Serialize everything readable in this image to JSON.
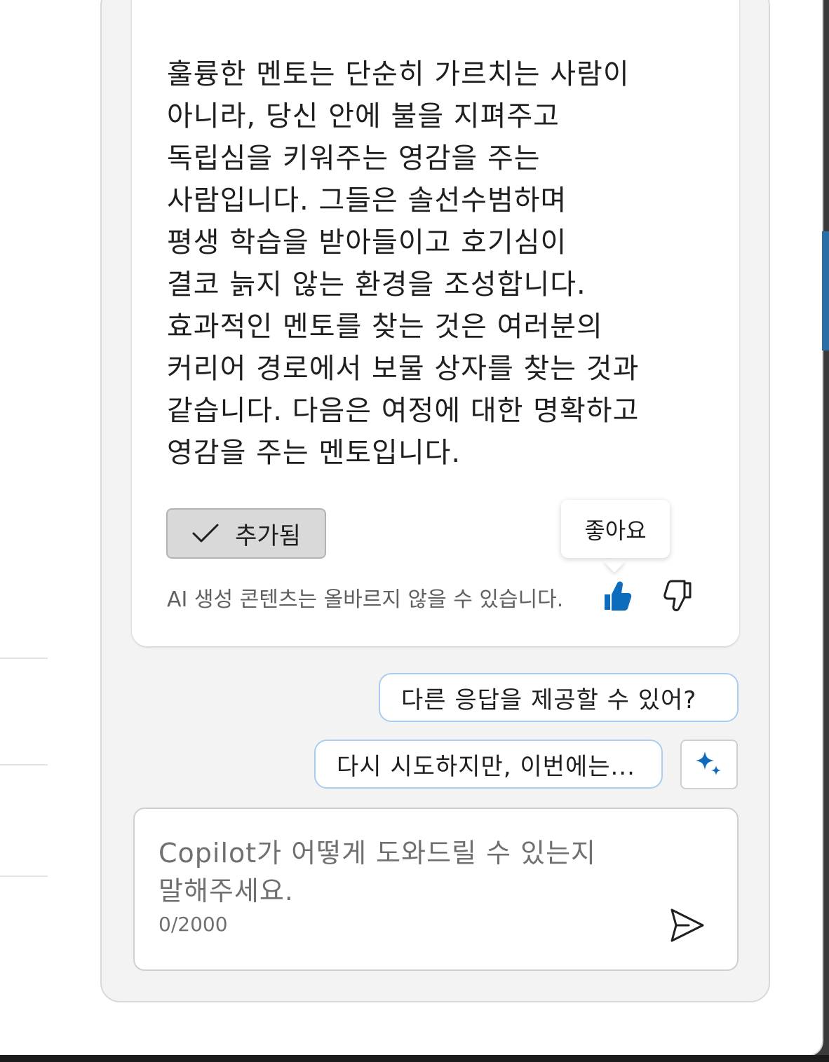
{
  "message": {
    "text": "훌륭한 멘토는 단순히 가르치는 사람이\n아니라, 당신 안에 불을 지펴주고\n독립심을 키워주는 영감을 주는\n사람입니다. 그들은 솔선수범하며\n평생 학습을 받아들이고 호기심이\n결코 늙지 않는 환경을 조성합니다.\n효과적인 멘토를 찾는 것은 여러분의\n커리어 경로에서 보물 상자를 찾는 것과\n같습니다. 다음은 여정에 대한 명확하고\n영감을 주는 멘토입니다."
  },
  "actions": {
    "added_label": "추가됨",
    "like_tooltip": "좋아요",
    "disclaimer": "AI 생성 콘텐츠는 올바르지 않을 수 있습니다."
  },
  "suggestions": [
    "다른 응답을 제공할 수 있어?",
    "다시 시도하지만, 이번에는..."
  ],
  "composer": {
    "placeholder": "Copilot가 어떻게 도와드릴 수 있는지\n말해주세요.",
    "char_count": "0/2000"
  },
  "icons": {
    "check": "check-icon",
    "thumb_up": "thumbs-up-icon",
    "thumb_down": "thumbs-down-icon",
    "sparkle": "sparkle-icon",
    "send": "send-icon"
  },
  "colors": {
    "accent": "#0f6cbd",
    "suggestion_border": "#a9cdf0",
    "panel_bg": "#f3f3f3"
  }
}
